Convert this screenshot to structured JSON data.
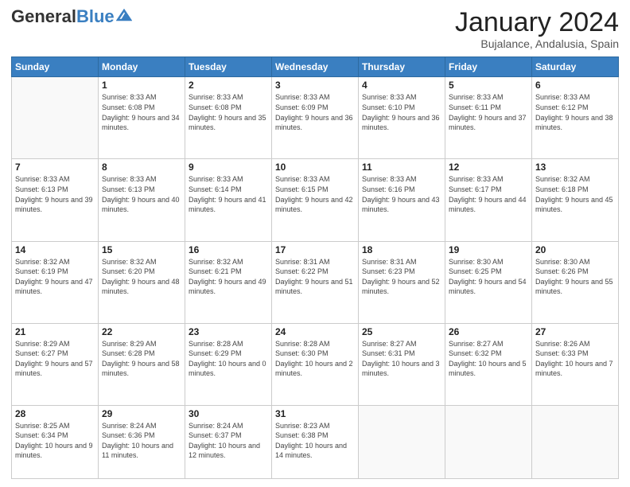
{
  "header": {
    "logo_general": "General",
    "logo_blue": "Blue",
    "month_title": "January 2024",
    "subtitle": "Bujalance, Andalusia, Spain"
  },
  "weekdays": [
    "Sunday",
    "Monday",
    "Tuesday",
    "Wednesday",
    "Thursday",
    "Friday",
    "Saturday"
  ],
  "weeks": [
    [
      {
        "day": "",
        "sunrise": "",
        "sunset": "",
        "daylight": ""
      },
      {
        "day": "1",
        "sunrise": "Sunrise: 8:33 AM",
        "sunset": "Sunset: 6:08 PM",
        "daylight": "Daylight: 9 hours and 34 minutes."
      },
      {
        "day": "2",
        "sunrise": "Sunrise: 8:33 AM",
        "sunset": "Sunset: 6:08 PM",
        "daylight": "Daylight: 9 hours and 35 minutes."
      },
      {
        "day": "3",
        "sunrise": "Sunrise: 8:33 AM",
        "sunset": "Sunset: 6:09 PM",
        "daylight": "Daylight: 9 hours and 36 minutes."
      },
      {
        "day": "4",
        "sunrise": "Sunrise: 8:33 AM",
        "sunset": "Sunset: 6:10 PM",
        "daylight": "Daylight: 9 hours and 36 minutes."
      },
      {
        "day": "5",
        "sunrise": "Sunrise: 8:33 AM",
        "sunset": "Sunset: 6:11 PM",
        "daylight": "Daylight: 9 hours and 37 minutes."
      },
      {
        "day": "6",
        "sunrise": "Sunrise: 8:33 AM",
        "sunset": "Sunset: 6:12 PM",
        "daylight": "Daylight: 9 hours and 38 minutes."
      }
    ],
    [
      {
        "day": "7",
        "sunrise": "Sunrise: 8:33 AM",
        "sunset": "Sunset: 6:13 PM",
        "daylight": "Daylight: 9 hours and 39 minutes."
      },
      {
        "day": "8",
        "sunrise": "Sunrise: 8:33 AM",
        "sunset": "Sunset: 6:13 PM",
        "daylight": "Daylight: 9 hours and 40 minutes."
      },
      {
        "day": "9",
        "sunrise": "Sunrise: 8:33 AM",
        "sunset": "Sunset: 6:14 PM",
        "daylight": "Daylight: 9 hours and 41 minutes."
      },
      {
        "day": "10",
        "sunrise": "Sunrise: 8:33 AM",
        "sunset": "Sunset: 6:15 PM",
        "daylight": "Daylight: 9 hours and 42 minutes."
      },
      {
        "day": "11",
        "sunrise": "Sunrise: 8:33 AM",
        "sunset": "Sunset: 6:16 PM",
        "daylight": "Daylight: 9 hours and 43 minutes."
      },
      {
        "day": "12",
        "sunrise": "Sunrise: 8:33 AM",
        "sunset": "Sunset: 6:17 PM",
        "daylight": "Daylight: 9 hours and 44 minutes."
      },
      {
        "day": "13",
        "sunrise": "Sunrise: 8:32 AM",
        "sunset": "Sunset: 6:18 PM",
        "daylight": "Daylight: 9 hours and 45 minutes."
      }
    ],
    [
      {
        "day": "14",
        "sunrise": "Sunrise: 8:32 AM",
        "sunset": "Sunset: 6:19 PM",
        "daylight": "Daylight: 9 hours and 47 minutes."
      },
      {
        "day": "15",
        "sunrise": "Sunrise: 8:32 AM",
        "sunset": "Sunset: 6:20 PM",
        "daylight": "Daylight: 9 hours and 48 minutes."
      },
      {
        "day": "16",
        "sunrise": "Sunrise: 8:32 AM",
        "sunset": "Sunset: 6:21 PM",
        "daylight": "Daylight: 9 hours and 49 minutes."
      },
      {
        "day": "17",
        "sunrise": "Sunrise: 8:31 AM",
        "sunset": "Sunset: 6:22 PM",
        "daylight": "Daylight: 9 hours and 51 minutes."
      },
      {
        "day": "18",
        "sunrise": "Sunrise: 8:31 AM",
        "sunset": "Sunset: 6:23 PM",
        "daylight": "Daylight: 9 hours and 52 minutes."
      },
      {
        "day": "19",
        "sunrise": "Sunrise: 8:30 AM",
        "sunset": "Sunset: 6:25 PM",
        "daylight": "Daylight: 9 hours and 54 minutes."
      },
      {
        "day": "20",
        "sunrise": "Sunrise: 8:30 AM",
        "sunset": "Sunset: 6:26 PM",
        "daylight": "Daylight: 9 hours and 55 minutes."
      }
    ],
    [
      {
        "day": "21",
        "sunrise": "Sunrise: 8:29 AM",
        "sunset": "Sunset: 6:27 PM",
        "daylight": "Daylight: 9 hours and 57 minutes."
      },
      {
        "day": "22",
        "sunrise": "Sunrise: 8:29 AM",
        "sunset": "Sunset: 6:28 PM",
        "daylight": "Daylight: 9 hours and 58 minutes."
      },
      {
        "day": "23",
        "sunrise": "Sunrise: 8:28 AM",
        "sunset": "Sunset: 6:29 PM",
        "daylight": "Daylight: 10 hours and 0 minutes."
      },
      {
        "day": "24",
        "sunrise": "Sunrise: 8:28 AM",
        "sunset": "Sunset: 6:30 PM",
        "daylight": "Daylight: 10 hours and 2 minutes."
      },
      {
        "day": "25",
        "sunrise": "Sunrise: 8:27 AM",
        "sunset": "Sunset: 6:31 PM",
        "daylight": "Daylight: 10 hours and 3 minutes."
      },
      {
        "day": "26",
        "sunrise": "Sunrise: 8:27 AM",
        "sunset": "Sunset: 6:32 PM",
        "daylight": "Daylight: 10 hours and 5 minutes."
      },
      {
        "day": "27",
        "sunrise": "Sunrise: 8:26 AM",
        "sunset": "Sunset: 6:33 PM",
        "daylight": "Daylight: 10 hours and 7 minutes."
      }
    ],
    [
      {
        "day": "28",
        "sunrise": "Sunrise: 8:25 AM",
        "sunset": "Sunset: 6:34 PM",
        "daylight": "Daylight: 10 hours and 9 minutes."
      },
      {
        "day": "29",
        "sunrise": "Sunrise: 8:24 AM",
        "sunset": "Sunset: 6:36 PM",
        "daylight": "Daylight: 10 hours and 11 minutes."
      },
      {
        "day": "30",
        "sunrise": "Sunrise: 8:24 AM",
        "sunset": "Sunset: 6:37 PM",
        "daylight": "Daylight: 10 hours and 12 minutes."
      },
      {
        "day": "31",
        "sunrise": "Sunrise: 8:23 AM",
        "sunset": "Sunset: 6:38 PM",
        "daylight": "Daylight: 10 hours and 14 minutes."
      },
      {
        "day": "",
        "sunrise": "",
        "sunset": "",
        "daylight": ""
      },
      {
        "day": "",
        "sunrise": "",
        "sunset": "",
        "daylight": ""
      },
      {
        "day": "",
        "sunrise": "",
        "sunset": "",
        "daylight": ""
      }
    ]
  ]
}
